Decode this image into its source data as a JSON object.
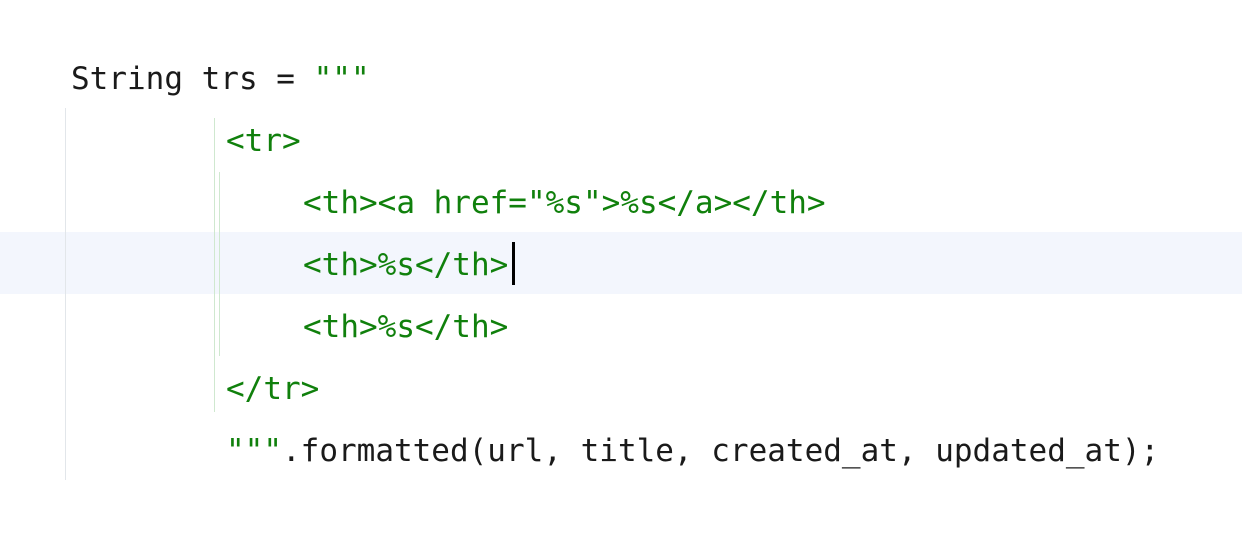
{
  "editor": {
    "lines": [
      {
        "decl": "String trs = ",
        "string": "\"\"\""
      },
      {
        "string": "<tr>"
      },
      {
        "string": "<th><a href=\"%s\">%s</a></th>"
      },
      {
        "string": "<th>%s</th>"
      },
      {
        "string": "<th>%s</th>"
      },
      {
        "string": "</tr>"
      },
      {
        "string": "\"\"\"",
        "call": ".formatted(url, title, created_at, updated_at);"
      }
    ],
    "highlighted_line": 4
  },
  "colors": {
    "string": "#10800c",
    "plain_text": "#1a1a1a",
    "current_line_bg": "#f3f6fd",
    "caret": "#000000"
  }
}
